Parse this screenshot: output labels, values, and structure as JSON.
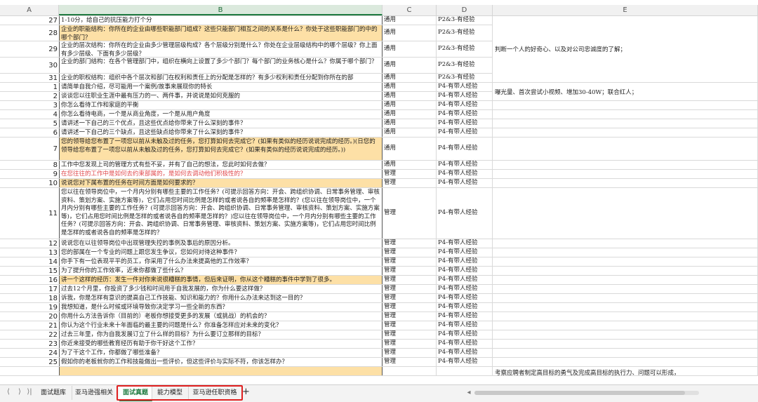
{
  "columns": [
    "A",
    "B",
    "C",
    "D",
    "E"
  ],
  "rows": [
    {
      "n": "27",
      "b": "1-10分，给自己的抗压能力打个分",
      "c": "通用",
      "d": "P2&3-有经验"
    },
    {
      "n": "28",
      "b": "企业的职能结构：你所在的企业由哪些职能部门组成？这些只能部门相互之间的关系是什么？你处于这些职能部门的中的哪个部门？",
      "c": "通用",
      "d": "P2&3-有经验",
      "hl": true
    },
    {
      "n": "29",
      "b": "企业的层次结构：你所在的企业由多少管理层级构成？各个层级分别是什么？你处在企业层级结构中的哪个层级？你上面有多少层级、下面有多少层级？",
      "c": "通用",
      "d": "P2&3-有经验"
    },
    {
      "n": "30",
      "b": "企业的部门结构：在各个管理部门中，组织在横向上设置了多少个部门？每个部门的业务核心是什么？你属于哪个部门？",
      "c": "通用",
      "d": "P2&3-有经验"
    },
    {
      "n": "31",
      "b": "企业的职权结构：组织中各个层次和部门在权利和责任上的分配是怎样的？有多少权利和责任分配到你所在的部",
      "c": "通用",
      "d": "P2&3-有经验"
    },
    {
      "n": "1",
      "b": "请简单自我介绍，尽可能用一个案例/故事来展现你的特长",
      "c": "通用",
      "d": "P4-有带人经验"
    },
    {
      "n": "2",
      "b": "谈谈您以往职业生涯中最有压力的一、两件事，并说说是如何克服的",
      "c": "通用",
      "d": "P4-有带人经验"
    },
    {
      "n": "3",
      "b": "你怎么看待工作和家庭的平衡",
      "c": "通用",
      "d": "P4-有带人经验"
    },
    {
      "n": "4",
      "b": "你怎么看待电商，一个是从商业角度，一个是从用户角度",
      "c": "通用",
      "d": "P4-有带人经验"
    },
    {
      "n": "5",
      "b": "请讲述一下自己的三个优点，且这些优点给你带来了什么深刻的事件？",
      "c": "通用",
      "d": "P4-有带人经验"
    },
    {
      "n": "6",
      "b": "请讲述一下自己的三个缺点，且这些缺点给你带来了什么深刻的事件？",
      "c": "通用",
      "d": "P4-有带人经验"
    },
    {
      "n": "7",
      "b": "您的领导给您布置了一项您以前从未触及过的任务，您打算如何去完成它？(如果有类似的经历说说完成的经历。)(日您的领导给您布置了一项您以前从未触及过的任务，您打算如何去完成它？(如果有类似的经历说说完成的经历。))",
      "c": "通用",
      "d": "P4-有带人经验",
      "hl": true
    },
    {
      "n": "8",
      "b": "工作中您发现上司的管理方式有些不妥，并有了自己的想法，您此时如何去做？",
      "c": "通用",
      "d": "P4-有带人经验"
    },
    {
      "n": "9",
      "b": "在您往往的工作中是如何去约束部属的，是如何去调动他们积极性的？",
      "c": "管理",
      "d": "P4-有带人经验",
      "pink": true
    },
    {
      "n": "10",
      "b": "说说您对下属布置的任务在时间方面是如何要求的？",
      "c": "管理",
      "d": "P4-有带人经验",
      "hl": true
    },
    {
      "n": "11",
      "b": "您以往在领导岗位中，一个月内分别有哪些主要的工作任务？(可提示回答方向：开会、跨组织协调、日常事务管理、审核资料、策划方案、实施方案等)，它们占用您时间比例是怎样的或者说各自的频率是怎样的？(您以往在领导岗位中，一个月内分别有哪些主要的工作任务？(可提示回答方向：开会、跨组织协调、日常事务管理、审核资料、策划方案、实施方案等)，它们占用您时间比例是怎样的或者说各自的频率是怎样的？)您以往在领导岗位中，一个月内分别有哪些主要的工作任务？(可提示回答方向：开会、跨组织协调、日常事务管理、审核资料、策划方案、实施方案等)，它们占用您时间比例是怎样的或者说各自的频率是怎样的？",
      "c": "管理",
      "d": "P4-有带人经验"
    },
    {
      "n": "12",
      "b": "说说您在以往领导岗位中出现管理失控的事例及事后的原因分析。",
      "c": "管理",
      "d": "P4-有带人经验"
    },
    {
      "n": "13",
      "b": "您的部属在一个专业的问题上跟您发生争议，您如何对待这种事件？",
      "c": "管理",
      "d": "P4-有带人经验"
    },
    {
      "n": "14",
      "b": "你手下有一位表现平平的员工，你采用了什么办法来提高他的工作效率？",
      "c": "管理",
      "d": "P4-有带人经验"
    },
    {
      "n": "15",
      "b": "为了提升你的工作效率，近来你都做了些什么？",
      "c": "管理",
      "d": "P4-有带人经验"
    },
    {
      "n": "16",
      "b": "讲一个这样的经历：发生一件对你来说很糟糕的事情，但后来证明，你从这个糟糕的事件中学到了很多。",
      "c": "管理",
      "d": "P4-有带人经验",
      "hl": true
    },
    {
      "n": "17",
      "b": "过去12个月里，你投资了多少钱和时间用于自我发展的，你为什么要这样做？",
      "c": "管理",
      "d": "P4-有带人经验"
    },
    {
      "n": "18",
      "b": "诉我，你是怎样有意识的提高自己工作技能、知识和能力的？你用什么办法来达到这一目的？",
      "c": "管理",
      "d": "P4-有带人经验"
    },
    {
      "n": "19",
      "b": "我想知道，是什么时候或环境导致你决定学习一些全新的东西？",
      "c": "管理",
      "d": "P4-有带人经验"
    },
    {
      "n": "20",
      "b": "你用什么方法告诉你（目前的）老板你想接受更多的发展（或挑战）的机会的？",
      "c": "管理",
      "d": "P4-有带人经验"
    },
    {
      "n": "21",
      "b": "你认为这个行业未来十年面临的最主要的问题是什么？你准备怎样应对未来的变化？",
      "c": "管理",
      "d": "P4-有带人经验"
    },
    {
      "n": "22",
      "b": "过去三年里，你为自我发展订立了什么样的目标？为什么要订立那样的目标？",
      "c": "管理",
      "d": "P4-有带人经验"
    },
    {
      "n": "23",
      "b": "你近来接受的哪些教育经历有助于你干好这个工作？",
      "c": "管理",
      "d": "P4-有带人经验"
    },
    {
      "n": "24",
      "b": "为了干这个工作，你都做了哪些准备？",
      "c": "管理",
      "d": "P4-有带人经验"
    },
    {
      "n": "25",
      "b": "假如你的老板就你的工作和技能做出一些评价，但这些评价与实际不符，你该怎样办？",
      "c": "管理",
      "d": "P4-有带人经验"
    },
    {
      "n": "",
      "b": "",
      "c": "",
      "d": "",
      "hl": true
    }
  ],
  "merged_e": [
    {
      "text": "判断一个人的好奇心、以及对公司忠诚度的了解；"
    },
    {
      "text": "曝光量、首次尝试小视频、增加30-40W；联合红人；"
    },
    {
      "text": "考察应聘者制定高目标的勇气及完成高目标的执行力、问题可以形成，"
    }
  ],
  "sheet_nav": [
    "⟨",
    "⟩",
    "⟩|"
  ],
  "tabs": [
    "面试题库",
    "亚马逊强相关",
    "面试真题",
    "能力模型",
    "亚马逊任职资格"
  ],
  "active_tab": 2,
  "add_tab": "+",
  "scroll_left": "◂"
}
